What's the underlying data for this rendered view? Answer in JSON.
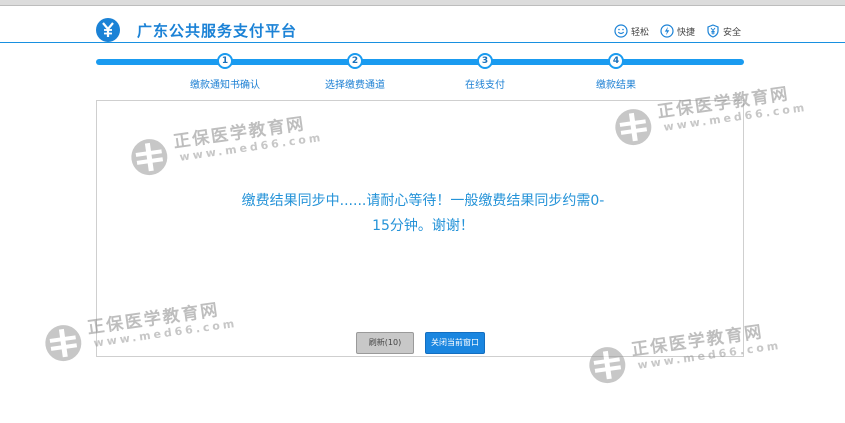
{
  "header": {
    "platform_title": "广东公共服务支付平台",
    "logo_icon": "yuan-icon",
    "brand_color": "#1b82d6",
    "features": [
      {
        "icon": "smile-icon",
        "label": "轻松"
      },
      {
        "icon": "lightning-icon",
        "label": "快捷"
      },
      {
        "icon": "shield-yuan-icon",
        "label": "安全"
      }
    ]
  },
  "progress": {
    "steps": [
      {
        "number": "1",
        "label": "缴款通知书确认"
      },
      {
        "number": "2",
        "label": "选择缴费通道"
      },
      {
        "number": "3",
        "label": "在线支付"
      },
      {
        "number": "4",
        "label": "缴款结果"
      }
    ]
  },
  "main": {
    "message_line1": "缴费结果同步中......请耐心等待！一般缴费结果同步约需0-",
    "message_line2": "15分钟。谢谢！",
    "refresh_label": "刷新(10)",
    "close_label": "关闭当前窗口"
  },
  "watermark": {
    "title": "正保医学教育网",
    "url": "www.med66.com"
  }
}
